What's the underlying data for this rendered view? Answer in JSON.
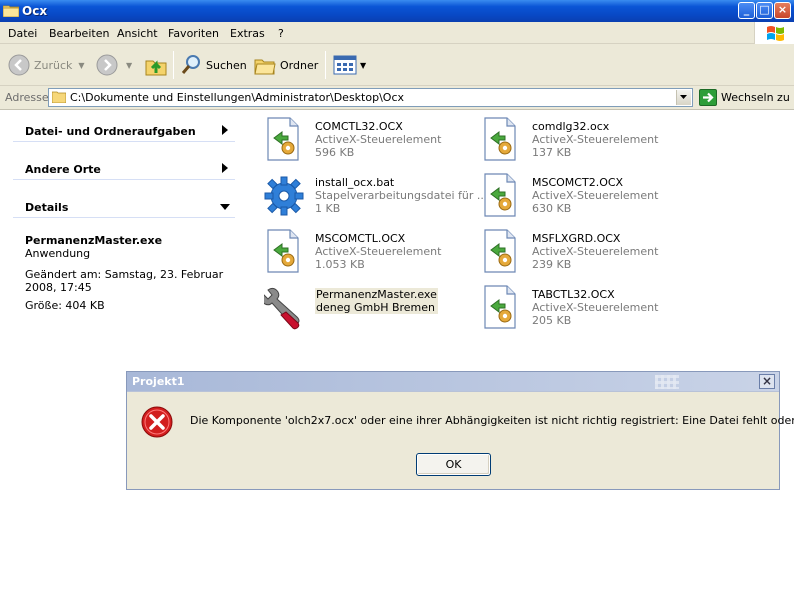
{
  "window": {
    "title": "Ocx",
    "buttons": {
      "minimize": "_",
      "maximize": "□",
      "close": "×"
    }
  },
  "menu": [
    "Datei",
    "Bearbeiten",
    "Ansicht",
    "Favoriten",
    "Extras",
    "?"
  ],
  "toolbar": {
    "back_label": "Zurück",
    "search_label": "Suchen",
    "folders_label": "Ordner"
  },
  "address": {
    "label": "Adresse",
    "path": "C:\\Dokumente und Einstellungen\\Administrator\\Desktop\\Ocx",
    "go_label": "Wechseln zu"
  },
  "taskpane": {
    "sections": [
      "Datei- und Ordneraufgaben",
      "Andere Orte",
      "Details"
    ],
    "details": {
      "name": "PermanenzMaster.exe",
      "type": "Anwendung",
      "modified": "Geändert am: Samstag, 23. Februar 2008, 17:45",
      "size": "Größe: 404 KB"
    }
  },
  "files": [
    {
      "name": "COMCTL32.OCX",
      "type": "ActiveX-Steuerelement",
      "size": "596 KB",
      "icon": "ocx-file-icon"
    },
    {
      "name": "comdlg32.ocx",
      "type": "ActiveX-Steuerelement",
      "size": "137 KB",
      "icon": "ocx-file-icon"
    },
    {
      "name": "install_ocx.bat",
      "type": "Stapelverarbeitungsdatei für ...",
      "size": "1 KB",
      "icon": "batch-gear-icon"
    },
    {
      "name": "MSCOMCT2.OCX",
      "type": "ActiveX-Steuerelement",
      "size": "630 KB",
      "icon": "ocx-file-icon"
    },
    {
      "name": "MSCOMCTL.OCX",
      "type": "ActiveX-Steuerelement",
      "size": "1.053 KB",
      "icon": "ocx-file-icon"
    },
    {
      "name": "MSFLXGRD.OCX",
      "type": "ActiveX-Steuerelement",
      "size": "239 KB",
      "icon": "ocx-file-icon"
    },
    {
      "name": "PermanenzMaster.exe",
      "type": "deneg GmbH Bremen",
      "size": "",
      "icon": "wrench-app-icon"
    },
    {
      "name": "TABCTL32.OCX",
      "type": "ActiveX-Steuerelement",
      "size": "205 KB",
      "icon": "ocx-file-icon"
    }
  ],
  "dialog": {
    "title": "Projekt1",
    "message": "Die Komponente 'olch2x7.ocx' oder eine ihrer Abhängigkeiten ist nicht richtig registriert: Eine Datei fehlt oder ist ungültig.",
    "ok_label": "OK",
    "close": "×",
    "icon": "error-icon"
  }
}
